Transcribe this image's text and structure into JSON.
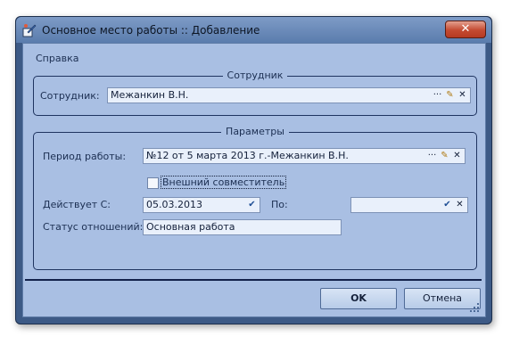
{
  "window": {
    "title": "Основное место работы :: Добавление",
    "close_label": "✕"
  },
  "menu": {
    "help": "Справка"
  },
  "employee_group": {
    "title": "Сотрудник",
    "label": "Сотрудник:",
    "value": "Меж анкин В.Н.",
    "more_icon": "ellipsis-icon",
    "edit_icon": "edit-pen-icon",
    "clear_icon": "clear-x-icon"
  },
  "params_group": {
    "title": "Параметры",
    "period_label": "Период работы:",
    "period_value": "№12 от 5 марта 2013 г.-Межанкин В.Н.",
    "external_checkbox_label": "Внешний совместитель",
    "external_checked": false,
    "valid_from_label": "Действует С:",
    "valid_from_value": "05.03.2013",
    "valid_to_label": "По:",
    "valid_to_value": "",
    "status_label": "Статус отношений:",
    "status_value": "Основная работа"
  },
  "buttons": {
    "ok": "OK",
    "cancel": "Отмена"
  }
}
